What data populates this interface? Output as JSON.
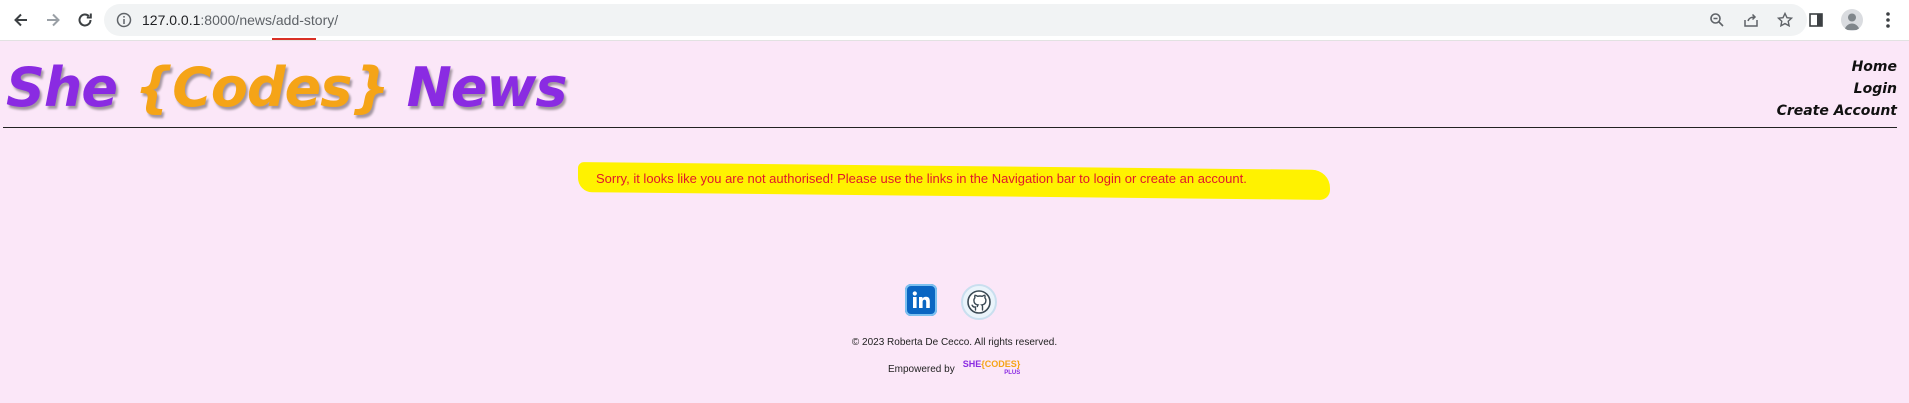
{
  "browser": {
    "url_host": "127.0.0.1",
    "url_port_path": ":8000/news/add-story/",
    "nav": {
      "back": "back-arrow",
      "forward": "forward-arrow",
      "reload": "reload"
    }
  },
  "site": {
    "logo_she": "She",
    "logo_codes": "{Codes}",
    "logo_news": "News",
    "nav": [
      {
        "label": "Home"
      },
      {
        "label": "Login"
      },
      {
        "label": "Create Account"
      }
    ]
  },
  "main": {
    "message": "Sorry, it looks like you are not authorised! Please use the links in the Navigation bar to login or create an account."
  },
  "footer": {
    "copyright": "© 2023 Roberta De Cecco. All rights reserved.",
    "empowered_by": "Empowered by",
    "badge_she": "SHE",
    "badge_codes": "{CODES}",
    "badge_plus": "PLUS"
  },
  "colors": {
    "page_bg": "#fbe7f8",
    "logo_purple": "#8a2be2",
    "logo_orange": "#f5a417",
    "message_red": "#e0182b",
    "highlight_yellow": "#fff200"
  }
}
